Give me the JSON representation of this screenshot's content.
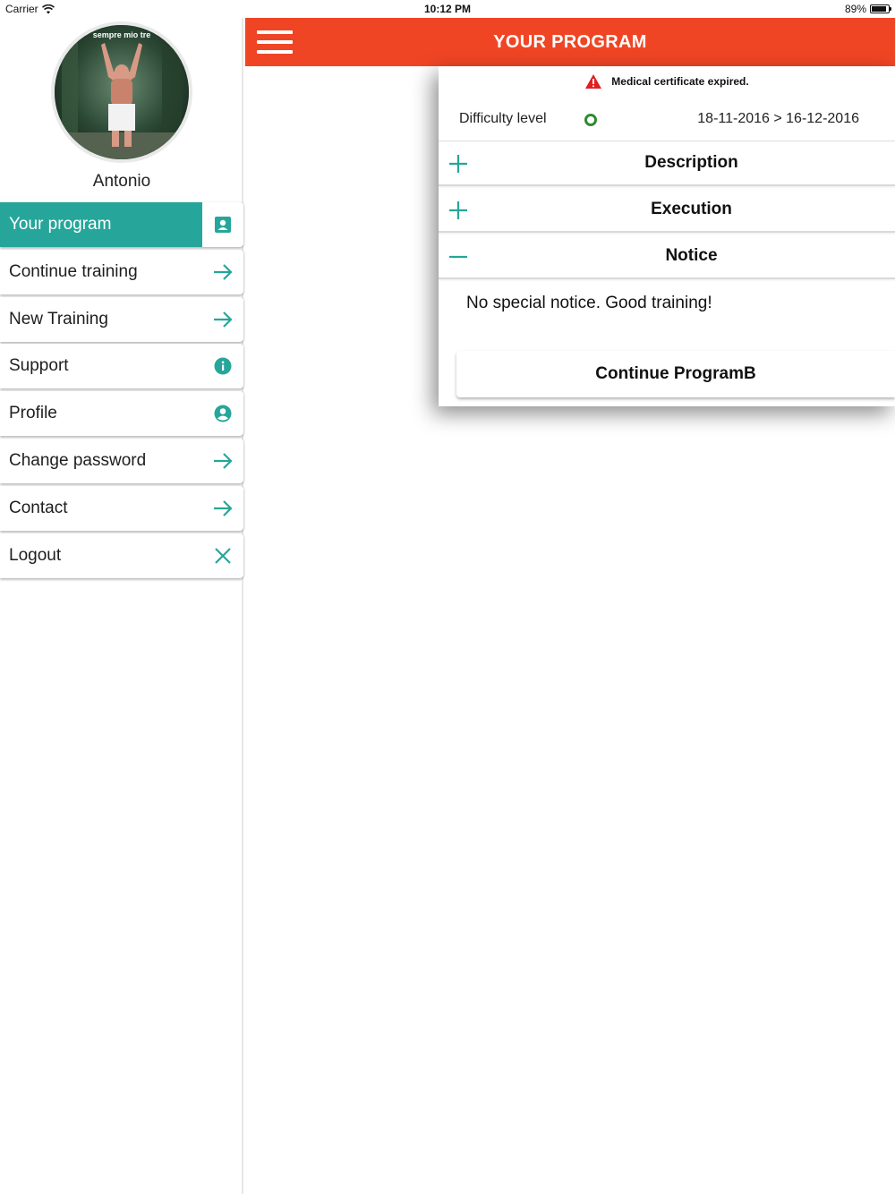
{
  "status_bar": {
    "carrier": "Carrier",
    "time": "10:12 PM",
    "battery": "89%",
    "battery_level": 0.89
  },
  "sidebar": {
    "user_name": "Antonio",
    "avatar_caption": "sempre mio tre",
    "items": [
      {
        "label": "Your program",
        "icon": "person-card-icon",
        "active": true
      },
      {
        "label": "Continue training",
        "icon": "arrow-right-icon"
      },
      {
        "label": "New Training",
        "icon": "arrow-right-icon"
      },
      {
        "label": "Support",
        "icon": "info-icon"
      },
      {
        "label": "Profile",
        "icon": "user-circle-icon"
      },
      {
        "label": "Change password",
        "icon": "arrow-right-icon"
      },
      {
        "label": "Contact",
        "icon": "arrow-right-icon"
      },
      {
        "label": "Logout",
        "icon": "close-icon"
      }
    ]
  },
  "header": {
    "title": "YOUR PROGRAM",
    "menu_icon": "hamburger-icon"
  },
  "program": {
    "alert_text": "Medical certificate expired.",
    "difficulty_label": "Difficulty level",
    "date_range": "18-11-2016 > 16-12-2016",
    "sections": [
      {
        "title": "Description",
        "state": "collapsed"
      },
      {
        "title": "Execution",
        "state": "collapsed"
      },
      {
        "title": "Notice",
        "state": "expanded"
      }
    ],
    "notice_text": "No special notice. Good training!",
    "continue_label": "Continue ProgramB"
  },
  "colors": {
    "accent": "#26a69a",
    "header": "#f04524",
    "alert": "#e02020",
    "difficulty": "#2e8b2e"
  }
}
